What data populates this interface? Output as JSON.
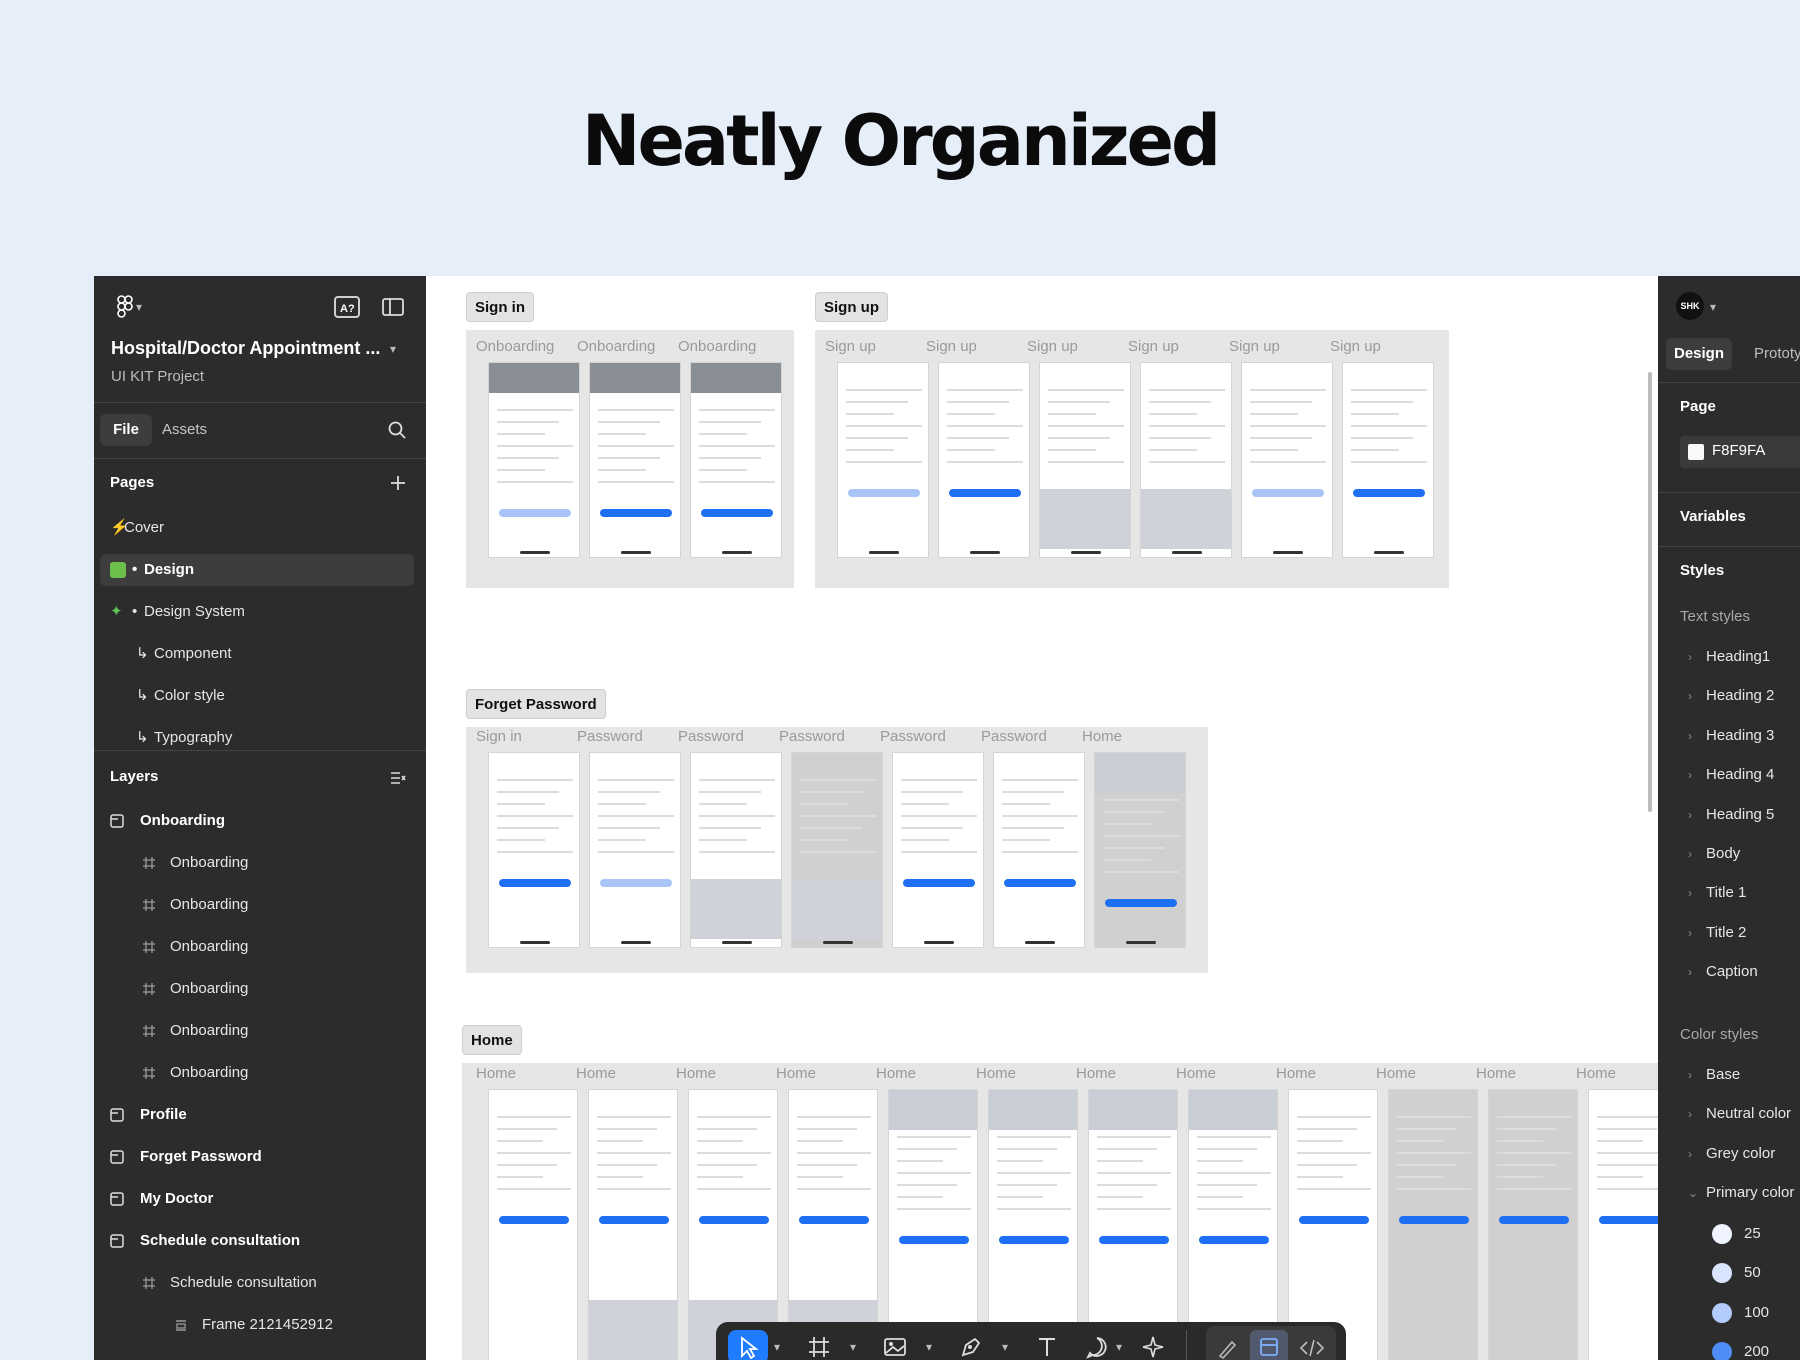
{
  "headline": "Neatly Organized",
  "file": {
    "project_name": "Hospital/Doctor Appointment ...",
    "project_sub": "UI KIT Project"
  },
  "tabs": {
    "file": "File",
    "assets": "Assets"
  },
  "pages": {
    "title": "Pages",
    "items": [
      {
        "label": "Cover",
        "prefix": "⚡"
      },
      {
        "label": "Design",
        "prefix": "•"
      },
      {
        "label": "Design System",
        "prefix": "•"
      },
      {
        "label": "Component",
        "prefix": "↳"
      },
      {
        "label": "Color style",
        "prefix": "↳"
      },
      {
        "label": "Typography",
        "prefix": "↳"
      }
    ]
  },
  "layers": {
    "title": "Layers",
    "items": [
      {
        "label": "Onboarding",
        "type": "section"
      },
      {
        "label": "Onboarding",
        "type": "frame"
      },
      {
        "label": "Onboarding",
        "type": "frame"
      },
      {
        "label": "Onboarding",
        "type": "frame"
      },
      {
        "label": "Onboarding",
        "type": "frame"
      },
      {
        "label": "Onboarding",
        "type": "frame"
      },
      {
        "label": "Onboarding",
        "type": "frame"
      },
      {
        "label": "Profile",
        "type": "section"
      },
      {
        "label": "Forget Password",
        "type": "section"
      },
      {
        "label": "My Doctor",
        "type": "section"
      },
      {
        "label": "Schedule consultation",
        "type": "section"
      },
      {
        "label": "Schedule consultation",
        "type": "frame"
      },
      {
        "label": "Frame 2121452912",
        "type": "group"
      }
    ]
  },
  "canvas": {
    "sections": {
      "signin": "Sign in",
      "signup": "Sign up",
      "forget": "Forget Password",
      "home": "Home"
    },
    "signin_frames": [
      "Onboarding",
      "Onboarding",
      "Onboarding"
    ],
    "signup_frames": [
      "Sign up",
      "Sign up",
      "Sign up",
      "Sign up",
      "Sign up",
      "Sign up"
    ],
    "forget_frames": [
      "Sign in",
      "Password",
      "Password",
      "Password",
      "Password",
      "Password",
      "Home"
    ],
    "home_frames": [
      "Home",
      "Home",
      "Home",
      "Home",
      "Home",
      "Home",
      "Home",
      "Home",
      "Home",
      "Home",
      "Home",
      "Home"
    ]
  },
  "right": {
    "avatar": "SHK",
    "tab_design": "Design",
    "tab_proto": "Prototy",
    "page_title": "Page",
    "page_color": "F8F9FA",
    "variables": "Variables",
    "styles": "Styles",
    "text_styles_title": "Text styles",
    "text_styles": [
      "Heading1",
      "Heading 2",
      "Heading 3",
      "Heading 4",
      "Heading 5",
      "Body",
      "Title 1",
      "Title 2",
      "Caption"
    ],
    "color_styles_title": "Color styles",
    "color_styles": [
      "Base",
      "Neutral color",
      "Grey color",
      "Primary color"
    ],
    "primary_shades": [
      {
        "label": "25",
        "color": "#eef3fe"
      },
      {
        "label": "50",
        "color": "#d8e5fd"
      },
      {
        "label": "100",
        "color": "#b3ccfb"
      },
      {
        "label": "200",
        "color": "#4f8df6"
      }
    ]
  },
  "colors": {
    "accent": "#1f7cff",
    "panel": "#2c2c2c",
    "page_bg": "#e6eefa"
  }
}
